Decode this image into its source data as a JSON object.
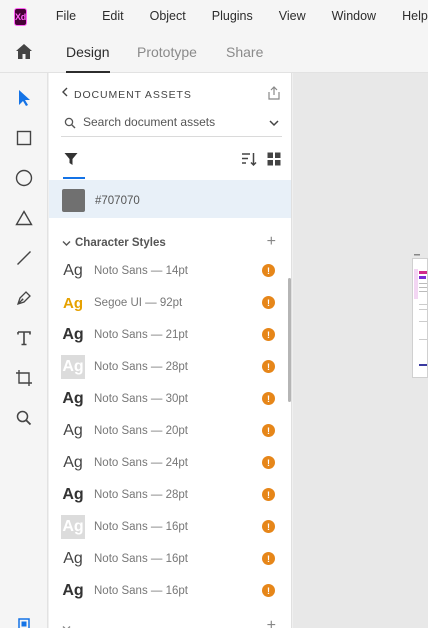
{
  "app": {
    "logo_text": "Xd"
  },
  "menu": [
    "File",
    "Edit",
    "Object",
    "Plugins",
    "View",
    "Window",
    "Help"
  ],
  "modes": {
    "design": "Design",
    "prototype": "Prototype",
    "share": "Share"
  },
  "panel": {
    "title": "DOCUMENT ASSETS",
    "search_placeholder": "Search document assets",
    "color": {
      "hex": "#707070",
      "label": "#707070"
    },
    "character_styles": {
      "title": "Character Styles",
      "items": [
        {
          "glyph": "Ag",
          "label": "Noto Sans — 14pt"
        },
        {
          "glyph": "Ag",
          "label": "Segoe UI — 92pt"
        },
        {
          "glyph": "Ag",
          "label": "Noto Sans — 21pt"
        },
        {
          "glyph": "Ag",
          "label": "Noto Sans — 28pt"
        },
        {
          "glyph": "Ag",
          "label": "Noto Sans — 30pt"
        },
        {
          "glyph": "Ag",
          "label": "Noto Sans — 20pt"
        },
        {
          "glyph": "Ag",
          "label": "Noto Sans — 24pt"
        },
        {
          "glyph": "Ag",
          "label": "Noto Sans — 28pt"
        },
        {
          "glyph": "Ag",
          "label": "Noto Sans — 16pt"
        },
        {
          "glyph": "Ag",
          "label": "Noto Sans — 16pt"
        },
        {
          "glyph": "Ag",
          "label": "Noto Sans — 16pt"
        }
      ]
    },
    "warning_glyph": "!"
  },
  "colors": {
    "accent": "#1473e6",
    "warning": "#e68619",
    "selected_row": "#e8f0f8",
    "xd_brand": "#ff61f6"
  }
}
